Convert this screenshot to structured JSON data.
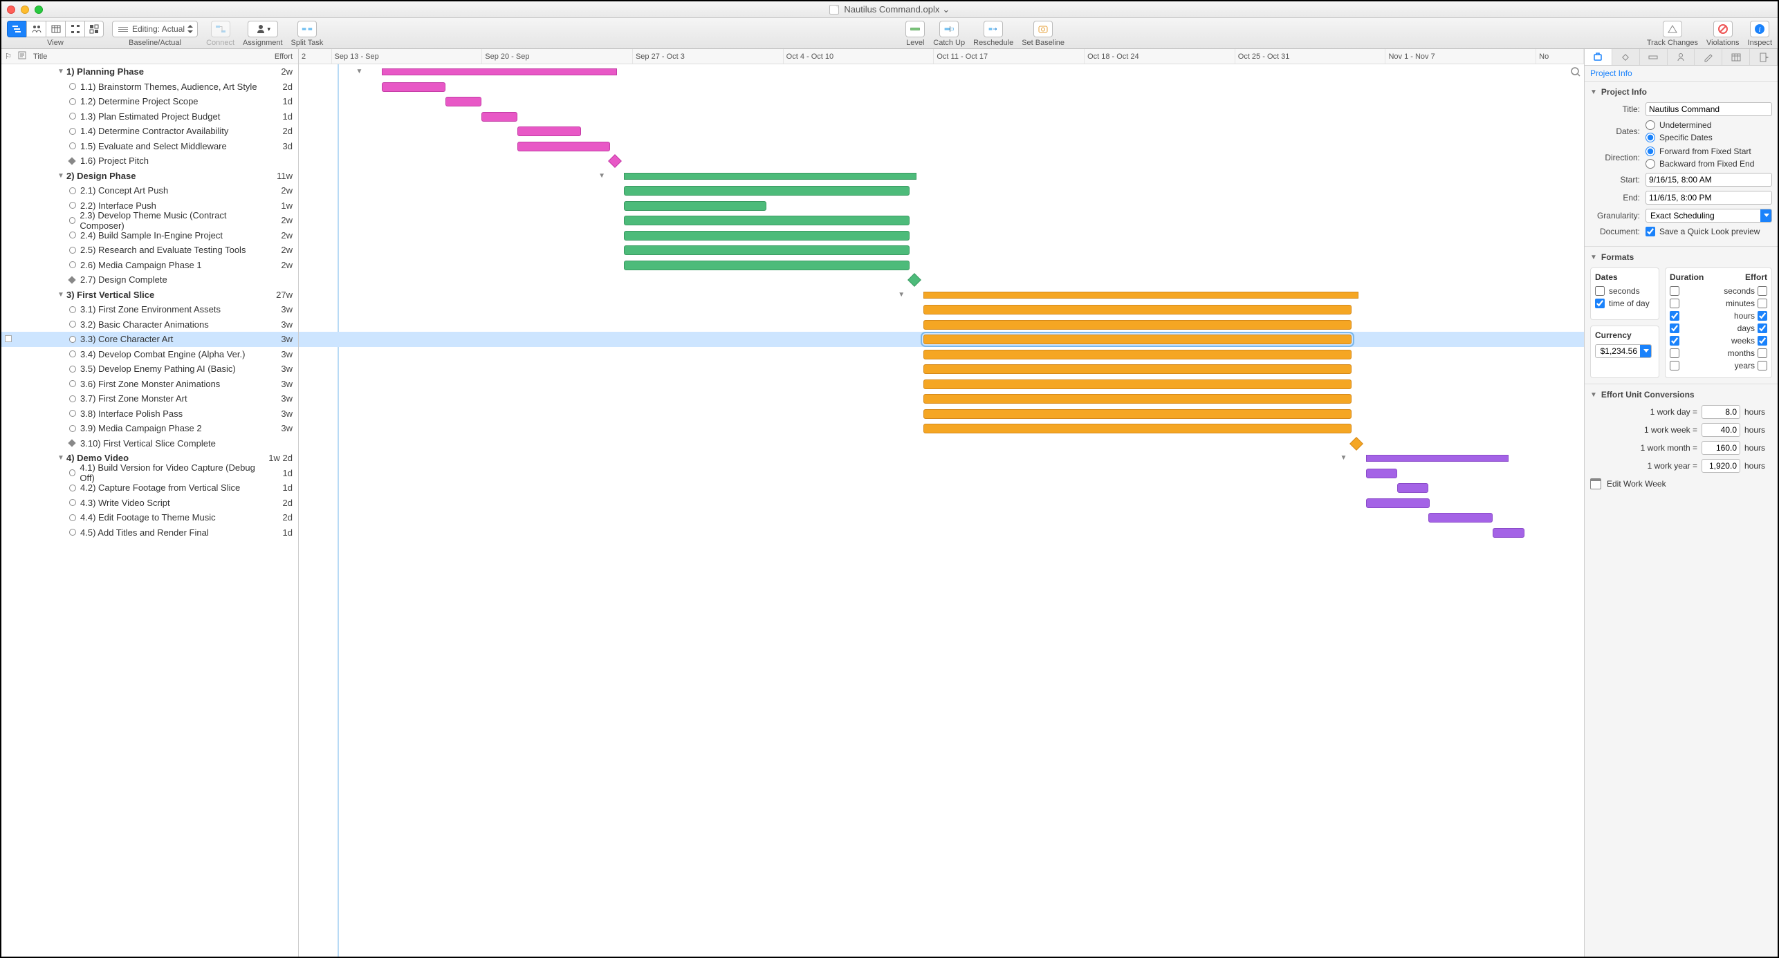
{
  "window": {
    "title": "Nautilus Command.oplx"
  },
  "toolbar": {
    "view_label": "View",
    "baseline_label": "Baseline/Actual",
    "editing_text": "Editing: Actual",
    "connect_label": "Connect",
    "assignment_label": "Assignment",
    "split_label": "Split Task",
    "level_label": "Level",
    "catchup_label": "Catch Up",
    "reschedule_label": "Reschedule",
    "setbaseline_label": "Set Baseline",
    "track_label": "Track Changes",
    "violations_label": "Violations",
    "inspect_label": "Inspect"
  },
  "outline": {
    "header": {
      "title": "Title",
      "effort": "Effort"
    },
    "rows": [
      {
        "type": "group",
        "num": "1)",
        "title": "Planning Phase",
        "effort": "2w",
        "indent": 0
      },
      {
        "type": "task",
        "num": "1.1)",
        "title": "Brainstorm Themes, Audience, Art Style",
        "effort": "2d",
        "indent": 1
      },
      {
        "type": "task",
        "num": "1.2)",
        "title": "Determine Project Scope",
        "effort": "1d",
        "indent": 1
      },
      {
        "type": "task",
        "num": "1.3)",
        "title": "Plan Estimated Project Budget",
        "effort": "1d",
        "indent": 1
      },
      {
        "type": "task",
        "num": "1.4)",
        "title": "Determine Contractor Availability",
        "effort": "2d",
        "indent": 1
      },
      {
        "type": "task",
        "num": "1.5)",
        "title": "Evaluate and Select Middleware",
        "effort": "3d",
        "indent": 1
      },
      {
        "type": "milestone",
        "num": "1.6)",
        "title": "Project Pitch",
        "effort": "",
        "indent": 1
      },
      {
        "type": "group",
        "num": "2)",
        "title": "Design Phase",
        "effort": "11w",
        "indent": 0
      },
      {
        "type": "task",
        "num": "2.1)",
        "title": "Concept Art Push",
        "effort": "2w",
        "indent": 1
      },
      {
        "type": "task",
        "num": "2.2)",
        "title": "Interface Push",
        "effort": "1w",
        "indent": 1
      },
      {
        "type": "task",
        "num": "2.3)",
        "title": "Develop Theme Music (Contract Composer)",
        "effort": "2w",
        "indent": 1
      },
      {
        "type": "task",
        "num": "2.4)",
        "title": "Build Sample In-Engine Project",
        "effort": "2w",
        "indent": 1
      },
      {
        "type": "task",
        "num": "2.5)",
        "title": "Research and Evaluate Testing Tools",
        "effort": "2w",
        "indent": 1
      },
      {
        "type": "task",
        "num": "2.6)",
        "title": "Media Campaign Phase 1",
        "effort": "2w",
        "indent": 1
      },
      {
        "type": "milestone",
        "num": "2.7)",
        "title": "Design Complete",
        "effort": "",
        "indent": 1
      },
      {
        "type": "group",
        "num": "3)",
        "title": "First Vertical Slice",
        "effort": "27w",
        "indent": 0
      },
      {
        "type": "task",
        "num": "3.1)",
        "title": "First Zone Environment Assets",
        "effort": "3w",
        "indent": 1
      },
      {
        "type": "task",
        "num": "3.2)",
        "title": "Basic Character Animations",
        "effort": "3w",
        "indent": 1
      },
      {
        "type": "task",
        "num": "3.3)",
        "title": "Core Character Art",
        "effort": "3w",
        "indent": 1,
        "selected": true
      },
      {
        "type": "task",
        "num": "3.4)",
        "title": "Develop Combat Engine (Alpha Ver.)",
        "effort": "3w",
        "indent": 1
      },
      {
        "type": "task",
        "num": "3.5)",
        "title": "Develop Enemy Pathing AI (Basic)",
        "effort": "3w",
        "indent": 1
      },
      {
        "type": "task",
        "num": "3.6)",
        "title": "First Zone Monster Animations",
        "effort": "3w",
        "indent": 1
      },
      {
        "type": "task",
        "num": "3.7)",
        "title": "First Zone Monster Art",
        "effort": "3w",
        "indent": 1
      },
      {
        "type": "task",
        "num": "3.8)",
        "title": "Interface Polish Pass",
        "effort": "3w",
        "indent": 1
      },
      {
        "type": "task",
        "num": "3.9)",
        "title": "Media Campaign Phase 2",
        "effort": "3w",
        "indent": 1
      },
      {
        "type": "milestone",
        "num": "3.10)",
        "title": "First Vertical Slice Complete",
        "effort": "",
        "indent": 1
      },
      {
        "type": "group",
        "num": "4)",
        "title": "Demo Video",
        "effort": "1w 2d",
        "indent": 0
      },
      {
        "type": "task",
        "num": "4.1)",
        "title": "Build Version for Video Capture (Debug Off)",
        "effort": "1d",
        "indent": 1
      },
      {
        "type": "task",
        "num": "4.2)",
        "title": "Capture Footage from Vertical Slice",
        "effort": "1d",
        "indent": 1
      },
      {
        "type": "task",
        "num": "4.3)",
        "title": "Write Video Script",
        "effort": "2d",
        "indent": 1
      },
      {
        "type": "task",
        "num": "4.4)",
        "title": "Edit Footage to Theme Music",
        "effort": "2d",
        "indent": 1
      },
      {
        "type": "task",
        "num": "4.5)",
        "title": "Add Titles and Render Final",
        "effort": "1d",
        "indent": 1
      }
    ]
  },
  "gantt": {
    "weeks": [
      "Sep 13 - Sep",
      "Sep 20 - Sep",
      "Sep 27 - Oct 3",
      "Oct 4 - Oct 10",
      "Oct 11 - Oct 17",
      "Oct 18 - Oct 24",
      "Oct 25 - Oct 31",
      "Nov 1 - Nov 7",
      "No"
    ]
  },
  "inspector": {
    "title_tab": "Project Info",
    "project_info": {
      "header": "Project Info",
      "title_label": "Title:",
      "title_value": "Nautilus Command",
      "dates_label": "Dates:",
      "dates_undetermined": "Undetermined",
      "dates_specific": "Specific Dates",
      "direction_label": "Direction:",
      "dir_forward": "Forward from Fixed Start",
      "dir_backward": "Backward from Fixed End",
      "start_label": "Start:",
      "start_value": "9/16/15, 8:00 AM",
      "end_label": "End:",
      "end_value": "11/6/15, 8:00 PM",
      "granularity_label": "Granularity:",
      "granularity_value": "Exact Scheduling",
      "document_label": "Document:",
      "quicklook": "Save a Quick Look preview"
    },
    "formats": {
      "header": "Formats",
      "dates_title": "Dates",
      "seconds": "seconds",
      "timeofday": "time of day",
      "currency_title": "Currency",
      "currency_value": "$1,234.56",
      "duration_title": "Duration",
      "effort_title": "Effort",
      "units": [
        "seconds",
        "minutes",
        "hours",
        "days",
        "weeks",
        "months",
        "years"
      ]
    },
    "conversions": {
      "header": "Effort Unit Conversions",
      "day_label": "1 work day =",
      "day_value": "8.0",
      "week_label": "1 work week =",
      "week_value": "40.0",
      "month_label": "1 work month =",
      "month_value": "160.0",
      "year_label": "1 work year =",
      "year_value": "1,920.0",
      "hours": "hours",
      "edit_ww": "Edit Work Week"
    }
  }
}
